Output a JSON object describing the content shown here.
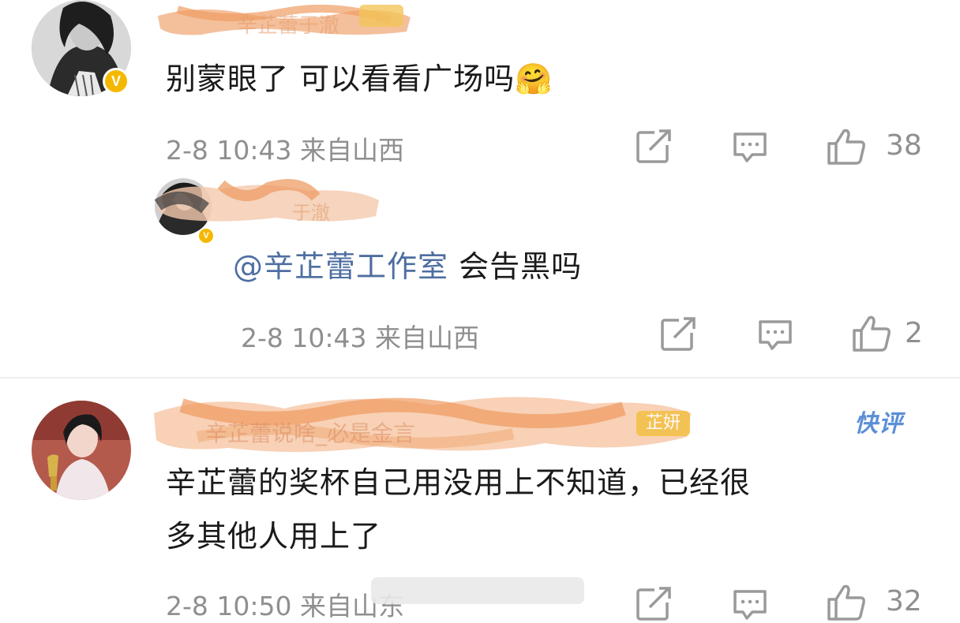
{
  "comments": [
    {
      "id": "c1",
      "username": "辛芷蕾于澈",
      "user_badge": "V",
      "text": "别蒙眼了 可以看看广场吗🤗",
      "time": "2-8 10:43",
      "location": "来自山西",
      "likes": "38",
      "reply": {
        "username": "于澈",
        "user_badge": "V",
        "mention": "@辛芷蕾工作室",
        "text": " 会告黑吗",
        "time": "2-8 10:43",
        "location": "来自山西",
        "likes": "2"
      }
    },
    {
      "id": "c2",
      "username": "辛芷蕾说啥_必是金言",
      "name_badge": "芷妍",
      "tag": "快评",
      "text_line1": "辛芷蕾的奖杯自己用没用上不知道，已经很",
      "text_line2": "多其他人用上了",
      "time": "2-8 10:50",
      "location": "来自山东",
      "likes": "32"
    }
  ],
  "icons": {
    "repost": "share-edit-icon",
    "comment": "comment-bubble-icon",
    "like": "thumbs-up-icon"
  },
  "colors": {
    "meta_gray": "#8f8f8f",
    "mention_blue": "#4e6ea1",
    "verified_gold": "#f5b800",
    "quick_tag_blue": "#5b8fd6"
  }
}
